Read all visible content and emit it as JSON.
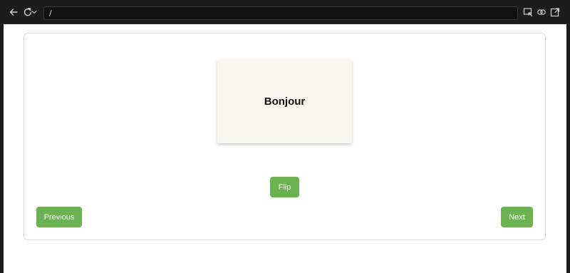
{
  "browser": {
    "url": "/",
    "icons": [
      "back-arrow-icon",
      "reload-icon",
      "chevron-down-icon",
      "screenshot-icon",
      "link-icon",
      "open-external-icon"
    ]
  },
  "flashcard": {
    "word": "Bonjour"
  },
  "buttons": {
    "flip": "Flip",
    "previous": "Previous",
    "next": "Next"
  },
  "colors": {
    "accent": "#6ab350",
    "card_bg": "#f8f5ec"
  }
}
